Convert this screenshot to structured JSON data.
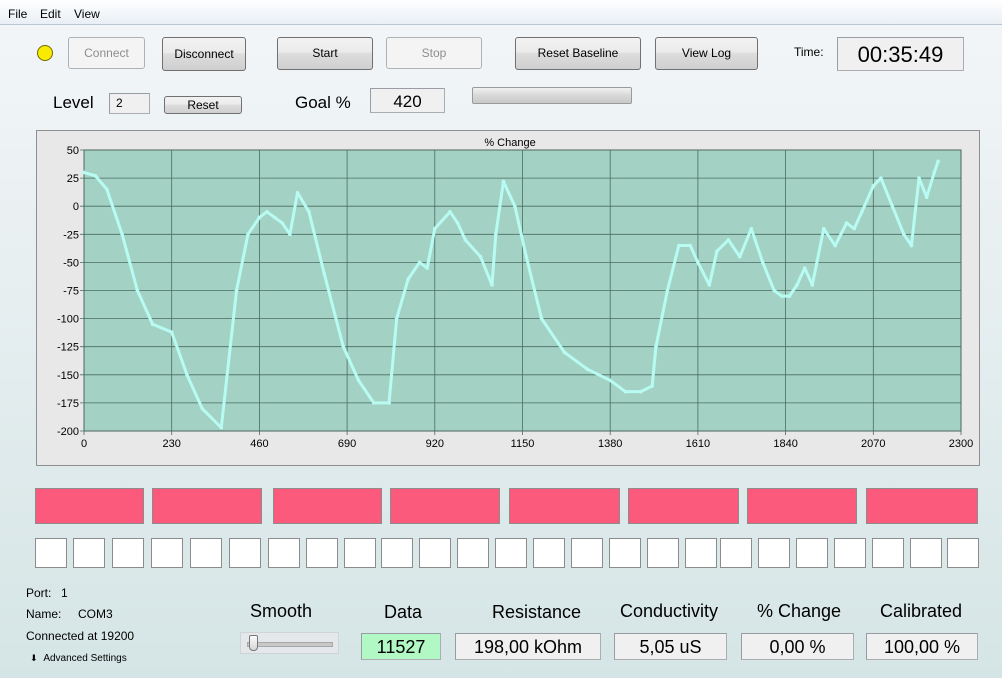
{
  "menu": {
    "items": [
      "File",
      "Edit",
      "View"
    ]
  },
  "toolbar": {
    "connect": "Connect",
    "disconnect": "Disconnect",
    "start": "Start",
    "stop": "Stop",
    "reset_baseline": "Reset Baseline",
    "view_log": "View Log",
    "time_label": "Time:",
    "time_value": "00:35:49",
    "status_color": "#f8ea00"
  },
  "level": {
    "label": "Level",
    "value": "2",
    "reset": "Reset"
  },
  "goal": {
    "label": "Goal %",
    "value": "420",
    "progress": 0
  },
  "chart_data": {
    "type": "scatter",
    "title": "% Change",
    "xlim": [
      0,
      2300
    ],
    "ylim": [
      -200,
      50
    ],
    "xticks": [
      0,
      230,
      460,
      690,
      920,
      1150,
      1380,
      1610,
      1840,
      2070,
      2300
    ],
    "yticks": [
      50,
      25,
      0,
      -25,
      -50,
      -75,
      -100,
      -125,
      -150,
      -175,
      -200
    ],
    "grid": true,
    "plot_bg": "#a3d2c5",
    "point_color": "#b8fbf2",
    "series": [
      {
        "x": [
          0,
          30,
          60,
          100,
          140,
          180,
          230,
          270,
          310,
          360,
          400
        ],
        "y": [
          30,
          27,
          15,
          -25,
          -75,
          -105,
          -112,
          -150,
          -180,
          -197,
          -75
        ]
      },
      {
        "x": [
          400,
          430,
          460,
          480,
          500,
          520,
          540,
          560,
          590,
          630,
          680,
          720,
          760,
          800
        ],
        "y": [
          -75,
          -25,
          -10,
          -5,
          -10,
          -15,
          -25,
          12,
          -5,
          -60,
          -125,
          -155,
          -175,
          -175
        ]
      },
      {
        "x": [
          800,
          820,
          850,
          880,
          900,
          920,
          960,
          980,
          1000,
          1040,
          1070,
          1080
        ],
        "y": [
          -175,
          -100,
          -65,
          -50,
          -55,
          -20,
          -5,
          -15,
          -30,
          -45,
          -70,
          -25
        ]
      },
      {
        "x": [
          1080,
          1100,
          1130,
          1160,
          1200,
          1260,
          1320,
          1380,
          1420,
          1460,
          1490,
          1500
        ],
        "y": [
          -25,
          22,
          0,
          -45,
          -100,
          -130,
          -145,
          -155,
          -165,
          -165,
          -160,
          -125
        ]
      },
      {
        "x": [
          1500,
          1530,
          1560,
          1590,
          1610,
          1640,
          1660,
          1690,
          1720,
          1750,
          1780,
          1810,
          1830,
          1850,
          1870,
          1890,
          1910
        ],
        "y": [
          -125,
          -75,
          -35,
          -35,
          -50,
          -70,
          -40,
          -30,
          -45,
          -20,
          -50,
          -75,
          -80,
          -80,
          -70,
          -55,
          -70
        ]
      },
      {
        "x": [
          1910,
          1940,
          1970,
          2000,
          2020,
          2040,
          2070,
          2090,
          2120,
          2150,
          2170,
          2190,
          2210,
          2230,
          2240
        ],
        "y": [
          -70,
          -20,
          -35,
          -15,
          -20,
          -5,
          18,
          25,
          0,
          -25,
          -35,
          25,
          8,
          30,
          40
        ]
      }
    ]
  },
  "status": {
    "port_label": "Port:",
    "port_value": "1",
    "name_label": "Name:",
    "name_value": "COM3",
    "connected": "Connected at 19200",
    "advanced": "Advanced Settings"
  },
  "readouts": {
    "smooth_label": "Smooth",
    "smooth_value": 0,
    "data_label": "Data",
    "data_value": "11527",
    "data_color": "#b1f8c4",
    "resistance_label": "Resistance",
    "resistance_value": "198,00 kOhm",
    "conductivity_label": "Conductivity",
    "conductivity_value": "5,05 uS",
    "pct_change_label": "% Change",
    "pct_change_value": "0,00 %",
    "calibrated_label": "Calibrated",
    "calibrated_value": "100,00 %"
  },
  "indicators": {
    "red_color": "#fc5a7c",
    "red_count": 8,
    "white_count": 25
  }
}
